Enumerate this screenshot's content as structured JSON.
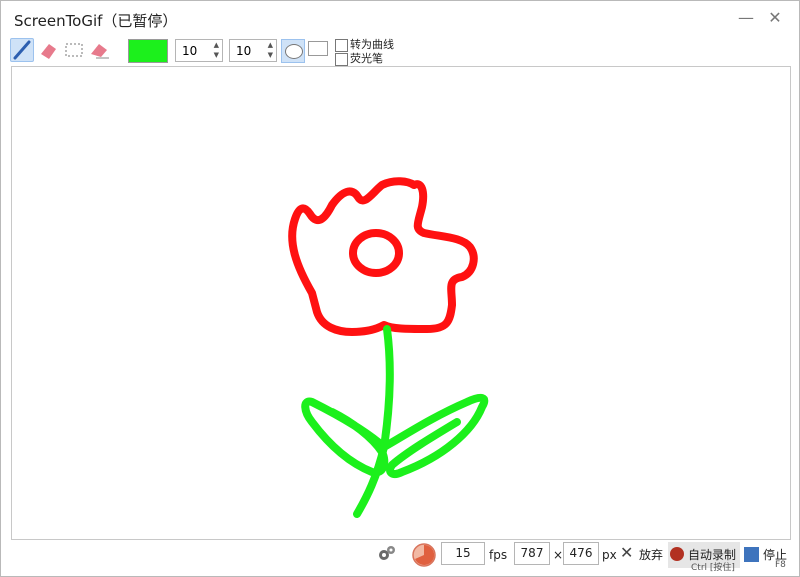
{
  "app": {
    "title": "ScreenToGif（已暂停）"
  },
  "window_controls": {
    "minimize": "—",
    "close": "✕"
  },
  "toolbar": {
    "tools": [
      {
        "name": "pen",
        "active": true
      },
      {
        "name": "highlighter-eraser",
        "active": false
      },
      {
        "name": "select-region",
        "active": false
      },
      {
        "name": "eraser",
        "active": false
      }
    ],
    "color": "#1cf01c",
    "width_value": "10",
    "height_value": "10",
    "shape_selected": "ellipse",
    "checkbox_curve_label": "转为曲线",
    "checkbox_highlighter_label": "荧光笔"
  },
  "canvas": {
    "drawing": "flower sketch"
  },
  "status": {
    "fps_value": "15",
    "fps_unit": "fps",
    "width_value": "787",
    "times": "×",
    "height_value": "476",
    "px_unit": "px",
    "discard_label": "放弃",
    "record_label": "自动录制",
    "record_shortcut": "Ctrl [按住]",
    "stop_label": "停止",
    "stop_shortcut": "F8"
  }
}
